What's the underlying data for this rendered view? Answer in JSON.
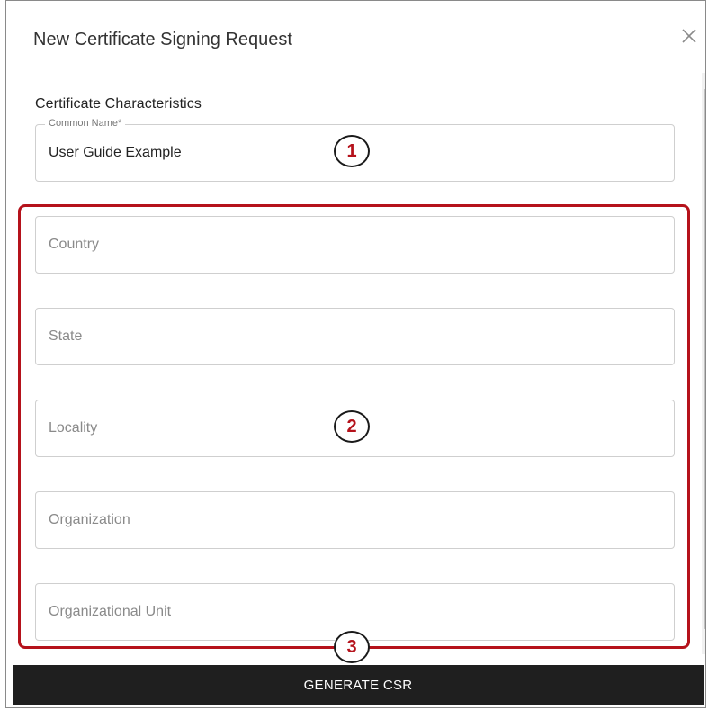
{
  "dialog": {
    "title": "New Certificate Signing Request",
    "close_icon": "close-icon"
  },
  "section": {
    "title": "Certificate Characteristics"
  },
  "fields": {
    "common_name": {
      "label": "Common Name*",
      "value": "User Guide Example"
    },
    "country": {
      "placeholder": "Country",
      "value": ""
    },
    "state": {
      "placeholder": "State",
      "value": ""
    },
    "locality": {
      "placeholder": "Locality",
      "value": ""
    },
    "organization": {
      "placeholder": "Organization",
      "value": ""
    },
    "organizational_unit": {
      "placeholder": "Organizational Unit",
      "value": ""
    }
  },
  "callouts": [
    "1",
    "2",
    "3"
  ],
  "actions": {
    "generate_label": "GENERATE CSR"
  },
  "colors": {
    "highlight": "#b5121b",
    "button_bg": "#1f1f1f",
    "callout_text": "#b5121b"
  }
}
